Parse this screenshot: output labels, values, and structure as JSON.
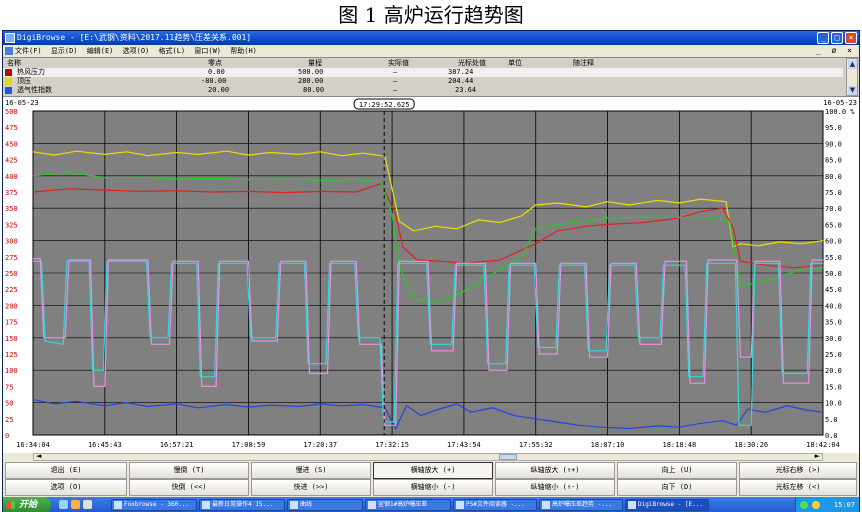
{
  "figure_caption": "图 1    高炉运行趋势图",
  "window": {
    "title": "DigiBrowse - [E:\\武钢\\资料\\2017.11趋势\\压差关系.001]",
    "controls": {
      "minimize": "_",
      "maximize": "□",
      "close": "×"
    }
  },
  "menu": {
    "items": [
      "文件(F)",
      "显示(D)",
      "编辑(E)",
      "选项(O)",
      "格式(L)",
      "窗口(W)",
      "帮助(H)"
    ],
    "mdi_controls": "_ ø ×"
  },
  "legend": {
    "headers": {
      "name": "名称",
      "zero": "零点",
      "span": "量程",
      "actual": "实际值",
      "cursor": "光标处值",
      "unit": "单位",
      "note": "随注释"
    },
    "rows": [
      {
        "name": "热风压力",
        "zero": "0.00",
        "span": "500.00",
        "actual": "—",
        "cursor": "387.24",
        "color": "#cc0000"
      },
      {
        "name": "顶压",
        "zero": "-80.00",
        "span": "280.00",
        "actual": "—",
        "cursor": "204.44",
        "color": "#e6d800"
      },
      {
        "name": "透气性指数",
        "zero": "20.00",
        "span": "80.00",
        "actual": "—",
        "cursor": "23.64",
        "color": "#2255dd"
      }
    ],
    "scroll_up": "▲",
    "scroll_down": "▼"
  },
  "plot": {
    "start_date": "16-05-23",
    "end_date": "16-05-23",
    "cursor_time": "17:29:52.625",
    "right_axis_unit": "%",
    "background": "#808080",
    "grid_color": "#000000"
  },
  "chart_data": {
    "type": "line",
    "x_ticks": [
      "16:34:04",
      "16:45:43",
      "16:57:21",
      "17:08:59",
      "17:20:37",
      "17:32:15",
      "17:43:54",
      "17:55:32",
      "18:07:10",
      "18:18:48",
      "18:30:26",
      "18:42:04"
    ],
    "y_left_ticks": [
      "500",
      "475",
      "450",
      "425",
      "400",
      "375",
      "350",
      "325",
      "300",
      "275",
      "250",
      "225",
      "200",
      "175",
      "150",
      "125",
      "100",
      "75",
      "50",
      "25",
      "0"
    ],
    "y_right_ticks": [
      "100.0",
      "95.0",
      "90.0",
      "85.0",
      "80.0",
      "75.0",
      "70.0",
      "65.0",
      "60.0",
      "55.0",
      "50.0",
      "45.0",
      "40.0",
      "35.0",
      "30.0",
      "25.0",
      "20.0",
      "15.0",
      "10.0",
      "5.0",
      "0.0"
    ],
    "ylim": [
      0,
      500
    ],
    "x_index_range": [
      0,
      11
    ],
    "cursor_x": 4.89,
    "series": [
      {
        "name": "顶压",
        "color": "#e8e000",
        "points": [
          [
            0,
            437
          ],
          [
            0.3,
            432
          ],
          [
            0.6,
            438
          ],
          [
            1,
            433
          ],
          [
            1.3,
            437
          ],
          [
            1.6,
            431
          ],
          [
            2,
            436
          ],
          [
            2.3,
            433
          ],
          [
            2.7,
            438
          ],
          [
            3,
            432
          ],
          [
            3.3,
            436
          ],
          [
            3.7,
            433
          ],
          [
            4,
            437
          ],
          [
            4.3,
            431
          ],
          [
            4.6,
            435
          ],
          [
            4.9,
            430
          ],
          [
            5.0,
            380
          ],
          [
            5.1,
            330
          ],
          [
            5.3,
            315
          ],
          [
            5.6,
            322
          ],
          [
            5.9,
            318
          ],
          [
            6.2,
            332
          ],
          [
            6.5,
            328
          ],
          [
            6.8,
            338
          ],
          [
            7.0,
            355
          ],
          [
            7.3,
            358
          ],
          [
            7.7,
            352
          ],
          [
            8.0,
            360
          ],
          [
            8.3,
            355
          ],
          [
            8.7,
            362
          ],
          [
            9.0,
            358
          ],
          [
            9.3,
            364
          ],
          [
            9.65,
            360
          ],
          [
            9.75,
            290
          ],
          [
            9.85,
            295
          ],
          [
            10.1,
            292
          ],
          [
            10.4,
            298
          ],
          [
            10.7,
            295
          ],
          [
            11,
            300
          ]
        ]
      },
      {
        "name": "热风压力",
        "color": "#e02020",
        "points": [
          [
            0,
            375
          ],
          [
            0.5,
            380
          ],
          [
            1,
            378
          ],
          [
            1.5,
            376
          ],
          [
            2,
            377
          ],
          [
            2.5,
            375
          ],
          [
            3,
            376
          ],
          [
            3.5,
            374
          ],
          [
            4,
            376
          ],
          [
            4.5,
            375
          ],
          [
            4.85,
            388
          ],
          [
            5.05,
            340
          ],
          [
            5.15,
            290
          ],
          [
            5.35,
            270
          ],
          [
            5.7,
            268
          ],
          [
            6.0,
            265
          ],
          [
            6.5,
            270
          ],
          [
            7.0,
            295
          ],
          [
            7.3,
            315
          ],
          [
            7.7,
            322
          ],
          [
            8.0,
            325
          ],
          [
            8.5,
            328
          ],
          [
            9.0,
            335
          ],
          [
            9.3,
            345
          ],
          [
            9.6,
            350
          ],
          [
            9.75,
            320
          ],
          [
            9.85,
            268
          ],
          [
            10.2,
            262
          ],
          [
            10.6,
            258
          ],
          [
            11,
            262
          ]
        ]
      },
      {
        "name": "绿线",
        "color": "#22cc22",
        "points": [
          [
            0,
            400
          ],
          [
            0.5,
            405
          ],
          [
            1,
            397
          ],
          [
            1.5,
            398
          ],
          [
            2,
            395
          ],
          [
            2.5,
            396
          ],
          [
            3,
            394
          ],
          [
            3.5,
            395
          ],
          [
            4,
            393
          ],
          [
            4.5,
            394
          ],
          [
            4.85,
            390
          ],
          [
            5.0,
            340
          ],
          [
            5.1,
            260
          ],
          [
            5.3,
            210
          ],
          [
            5.6,
            205
          ],
          [
            5.9,
            215
          ],
          [
            6.2,
            235
          ],
          [
            6.5,
            255
          ],
          [
            6.8,
            275
          ],
          [
            7.0,
            318
          ],
          [
            7.3,
            325
          ],
          [
            7.7,
            330
          ],
          [
            8.0,
            335
          ],
          [
            8.5,
            336
          ],
          [
            9.0,
            336
          ],
          [
            9.4,
            335
          ],
          [
            9.7,
            330
          ],
          [
            9.85,
            230
          ],
          [
            10.1,
            235
          ],
          [
            10.4,
            245
          ],
          [
            10.7,
            255
          ],
          [
            11,
            258
          ]
        ]
      },
      {
        "name": "透气性指数",
        "color": "#2244dd",
        "points": [
          [
            0,
            55
          ],
          [
            0.3,
            48
          ],
          [
            0.6,
            52
          ],
          [
            1,
            45
          ],
          [
            1.3,
            50
          ],
          [
            1.6,
            44
          ],
          [
            2,
            48
          ],
          [
            2.3,
            42
          ],
          [
            2.7,
            47
          ],
          [
            3,
            43
          ],
          [
            3.3,
            46
          ],
          [
            3.7,
            44
          ],
          [
            4,
            48
          ],
          [
            4.3,
            45
          ],
          [
            4.6,
            47
          ],
          [
            4.9,
            42
          ],
          [
            5.05,
            10
          ],
          [
            5.2,
            45
          ],
          [
            5.4,
            30
          ],
          [
            5.6,
            38
          ],
          [
            5.9,
            48
          ],
          [
            6.1,
            35
          ],
          [
            6.4,
            42
          ],
          [
            6.7,
            30
          ],
          [
            7.0,
            25
          ],
          [
            7.3,
            20
          ],
          [
            7.6,
            15
          ],
          [
            7.9,
            12
          ],
          [
            8.3,
            10
          ],
          [
            8.7,
            14
          ],
          [
            9.0,
            12
          ],
          [
            9.3,
            18
          ],
          [
            9.6,
            22
          ],
          [
            9.8,
            15
          ],
          [
            9.95,
            40
          ],
          [
            10.2,
            35
          ],
          [
            10.5,
            45
          ],
          [
            10.8,
            38
          ],
          [
            11,
            35
          ]
        ]
      },
      {
        "name": "粉线",
        "color": "#e890e8",
        "points": [
          [
            0,
            272
          ],
          [
            0.1,
            272
          ],
          [
            0.15,
            150
          ],
          [
            0.45,
            150
          ],
          [
            0.5,
            270
          ],
          [
            0.8,
            270
          ],
          [
            0.85,
            75
          ],
          [
            1.0,
            75
          ],
          [
            1.05,
            270
          ],
          [
            1.6,
            270
          ],
          [
            1.65,
            140
          ],
          [
            1.9,
            140
          ],
          [
            1.95,
            268
          ],
          [
            2.3,
            268
          ],
          [
            2.35,
            75
          ],
          [
            2.55,
            75
          ],
          [
            2.6,
            268
          ],
          [
            3.0,
            268
          ],
          [
            3.05,
            145
          ],
          [
            3.4,
            145
          ],
          [
            3.45,
            268
          ],
          [
            3.8,
            268
          ],
          [
            3.85,
            95
          ],
          [
            4.1,
            95
          ],
          [
            4.15,
            268
          ],
          [
            4.5,
            268
          ],
          [
            4.55,
            140
          ],
          [
            4.85,
            140
          ],
          [
            4.9,
            15
          ],
          [
            5.05,
            15
          ],
          [
            5.1,
            268
          ],
          [
            5.5,
            268
          ],
          [
            5.55,
            130
          ],
          [
            5.85,
            130
          ],
          [
            5.9,
            265
          ],
          [
            6.3,
            265
          ],
          [
            6.35,
            100
          ],
          [
            6.6,
            100
          ],
          [
            6.65,
            265
          ],
          [
            7.0,
            265
          ],
          [
            7.05,
            125
          ],
          [
            7.3,
            125
          ],
          [
            7.35,
            265
          ],
          [
            7.7,
            265
          ],
          [
            7.75,
            120
          ],
          [
            8.0,
            120
          ],
          [
            8.05,
            265
          ],
          [
            8.4,
            265
          ],
          [
            8.45,
            140
          ],
          [
            8.75,
            140
          ],
          [
            8.8,
            268
          ],
          [
            9.1,
            268
          ],
          [
            9.15,
            80
          ],
          [
            9.35,
            80
          ],
          [
            9.4,
            270
          ],
          [
            9.8,
            270
          ],
          [
            9.85,
            120
          ],
          [
            10.0,
            120
          ],
          [
            10.05,
            268
          ],
          [
            10.4,
            268
          ],
          [
            10.45,
            80
          ],
          [
            10.8,
            80
          ],
          [
            10.85,
            270
          ],
          [
            11,
            270
          ]
        ]
      },
      {
        "name": "青线",
        "color": "#33d8d8",
        "points": [
          [
            0,
            268
          ],
          [
            0.12,
            268
          ],
          [
            0.17,
            145
          ],
          [
            0.42,
            140
          ],
          [
            0.47,
            268
          ],
          [
            0.78,
            268
          ],
          [
            0.83,
            100
          ],
          [
            0.98,
            100
          ],
          [
            1.03,
            268
          ],
          [
            1.58,
            268
          ],
          [
            1.63,
            150
          ],
          [
            1.88,
            150
          ],
          [
            1.93,
            265
          ],
          [
            2.28,
            265
          ],
          [
            2.33,
            90
          ],
          [
            2.53,
            90
          ],
          [
            2.58,
            265
          ],
          [
            2.98,
            265
          ],
          [
            3.03,
            150
          ],
          [
            3.38,
            150
          ],
          [
            3.43,
            265
          ],
          [
            3.78,
            265
          ],
          [
            3.83,
            110
          ],
          [
            4.08,
            110
          ],
          [
            4.13,
            265
          ],
          [
            4.48,
            265
          ],
          [
            4.53,
            150
          ],
          [
            4.83,
            150
          ],
          [
            4.88,
            20
          ],
          [
            5.03,
            20
          ],
          [
            5.08,
            265
          ],
          [
            5.48,
            265
          ],
          [
            5.53,
            140
          ],
          [
            5.83,
            140
          ],
          [
            5.88,
            262
          ],
          [
            6.28,
            262
          ],
          [
            6.33,
            110
          ],
          [
            6.58,
            110
          ],
          [
            6.63,
            262
          ],
          [
            6.98,
            262
          ],
          [
            7.03,
            135
          ],
          [
            7.28,
            135
          ],
          [
            7.33,
            262
          ],
          [
            7.68,
            262
          ],
          [
            7.73,
            130
          ],
          [
            7.98,
            130
          ],
          [
            8.03,
            262
          ],
          [
            8.38,
            262
          ],
          [
            8.43,
            150
          ],
          [
            8.73,
            150
          ],
          [
            8.78,
            262
          ],
          [
            9.08,
            262
          ],
          [
            9.13,
            90
          ],
          [
            9.33,
            90
          ],
          [
            9.38,
            265
          ],
          [
            9.78,
            265
          ],
          [
            9.83,
            15
          ],
          [
            10.0,
            15
          ],
          [
            10.05,
            265
          ],
          [
            10.38,
            265
          ],
          [
            10.43,
            95
          ],
          [
            10.78,
            95
          ],
          [
            10.83,
            265
          ],
          [
            11,
            265
          ]
        ]
      }
    ]
  },
  "scrollbar": {
    "left": "◄",
    "right": "►"
  },
  "buttons": {
    "row1": [
      "退出 (E)",
      "慢倒 (T)",
      "慢进 (S)",
      "横轴放大 (+)",
      "纵轴放大 (↑+)",
      "向上 (U)",
      "光标右移 (>)"
    ],
    "row2": [
      "选项 (O)",
      "快倒 (<<)",
      "快进 (>>)",
      "横轴缩小 (-)",
      "纵轴缩小 (↑-)",
      "向下 (D)",
      "光标左移 (<)"
    ]
  },
  "taskbar": {
    "start": "开始",
    "tasks": [
      "Foxbrowse - 360...",
      "最新日常操作4 15...",
      "曲线",
      "宣钢1#高炉曝压差",
      "PS#文件阅读器 -...",
      "高炉曝压差趋势 -...",
      "DigiBrowse - [E..."
    ],
    "clock": "15:07"
  }
}
